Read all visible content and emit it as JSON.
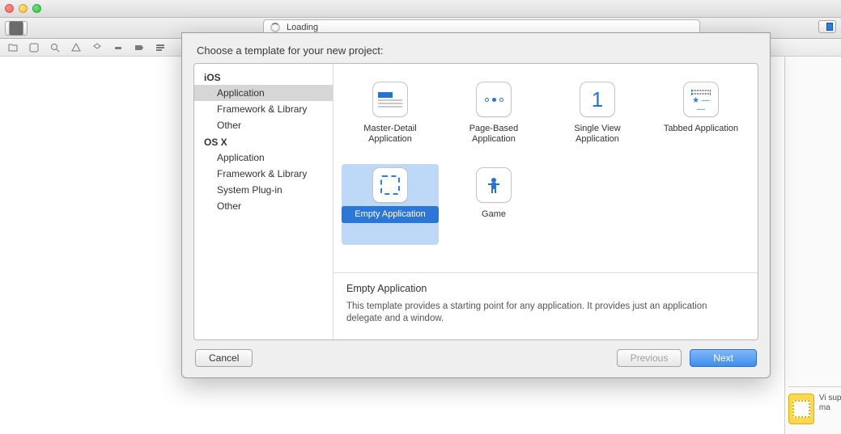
{
  "toolbar": {
    "loading_text": "Loading"
  },
  "sheet": {
    "header": "Choose a template for your new project:",
    "categories": [
      {
        "group": "iOS",
        "items": [
          "Application",
          "Framework & Library",
          "Other"
        ]
      },
      {
        "group": "OS X",
        "items": [
          "Application",
          "Framework & Library",
          "System Plug-in",
          "Other"
        ]
      }
    ],
    "selected_category_group": "iOS",
    "selected_category_item": "Application",
    "templates": [
      {
        "id": "master-detail",
        "label": "Master-Detail Application"
      },
      {
        "id": "page-based",
        "label": "Page-Based Application"
      },
      {
        "id": "single-view",
        "label": "Single View Application"
      },
      {
        "id": "tabbed",
        "label": "Tabbed Application"
      },
      {
        "id": "empty",
        "label": "Empty Application"
      },
      {
        "id": "game",
        "label": "Game"
      }
    ],
    "selected_template": "empty",
    "description": {
      "title": "Empty Application",
      "body": "This template provides a starting point for any application. It provides just an application delegate and a window."
    },
    "buttons": {
      "cancel": "Cancel",
      "previous": "Previous",
      "next": "Next"
    }
  },
  "library": {
    "obj_label": "Vi\nsup\nma"
  }
}
